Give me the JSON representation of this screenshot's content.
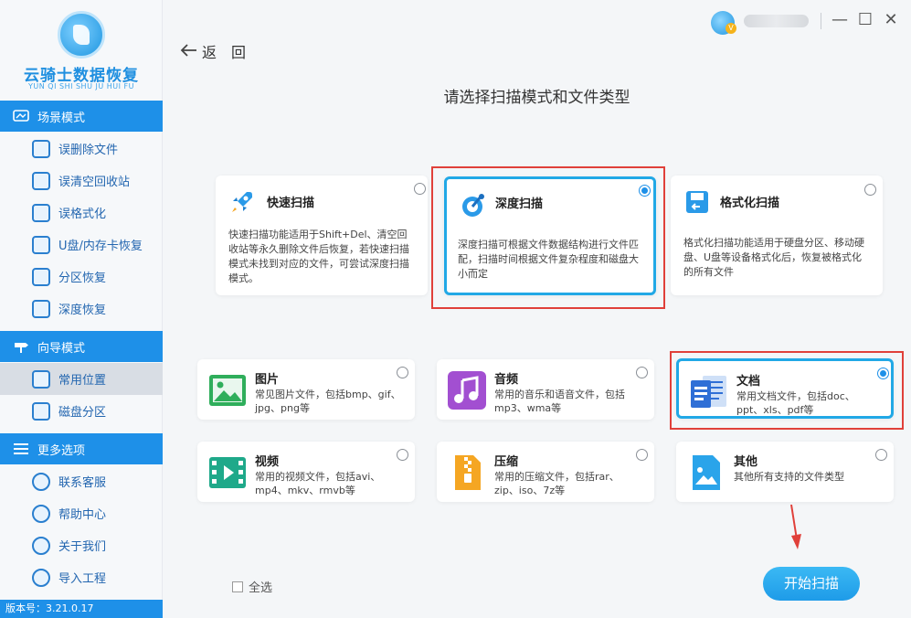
{
  "app": {
    "title": "云骑士数据恢复",
    "subtitle": "YUN QI SHI SHU JU HUI FU",
    "version": "版本号：3.21.0.17"
  },
  "sidebar": {
    "sections": [
      {
        "label": "场景模式",
        "items": [
          {
            "label": "误删除文件",
            "icon": "deleted-file-icon"
          },
          {
            "label": "误清空回收站",
            "icon": "recycle-bin-icon"
          },
          {
            "label": "误格式化",
            "icon": "format-icon"
          },
          {
            "label": "U盘/内存卡恢复",
            "icon": "usb-card-icon"
          },
          {
            "label": "分区恢复",
            "icon": "partition-icon"
          },
          {
            "label": "深度恢复",
            "icon": "deep-recovery-icon"
          }
        ]
      },
      {
        "label": "向导模式",
        "items": [
          {
            "label": "常用位置",
            "icon": "common-location-icon",
            "active": true
          },
          {
            "label": "磁盘分区",
            "icon": "disk-partition-icon"
          }
        ]
      },
      {
        "label": "更多选项",
        "items": [
          {
            "label": "联系客服",
            "icon": "customer-service-icon"
          },
          {
            "label": "帮助中心",
            "icon": "help-icon"
          },
          {
            "label": "关于我们",
            "icon": "about-icon"
          },
          {
            "label": "导入工程",
            "icon": "import-project-icon"
          }
        ]
      }
    ]
  },
  "header": {
    "back_label": "返　回",
    "window_controls": [
      "—",
      "☐",
      "✕"
    ]
  },
  "main": {
    "title": "请选择扫描模式和文件类型",
    "modes": [
      {
        "title": "快速扫描",
        "desc": "快速扫描功能适用于Shift+Del、清空回收站等永久删除文件后恢复，若快速扫描模式未找到对应的文件，可尝试深度扫描模式。",
        "selected": false,
        "icon": "rocket-icon"
      },
      {
        "title": "深度扫描",
        "desc": "深度扫描可根据文件数据结构进行文件匹配，扫描时间根据文件复杂程度和磁盘大小而定",
        "selected": true,
        "icon": "deep-scan-icon"
      },
      {
        "title": "格式化扫描",
        "desc": "格式化扫描功能适用于硬盘分区、移动硬盘、U盘等设备格式化后，恢复被格式化的所有文件",
        "selected": false,
        "icon": "format-scan-icon"
      }
    ],
    "file_types": [
      {
        "title": "图片",
        "desc": "常见图片文件，包括bmp、gif、jpg、png等",
        "selected": false,
        "icon": "image-icon",
        "color": "#2fae5b"
      },
      {
        "title": "音频",
        "desc": "常用的音乐和语音文件，包括mp3、wma等",
        "selected": false,
        "icon": "audio-icon",
        "color": "#a24fd1"
      },
      {
        "title": "文档",
        "desc": "常用文档文件，包括doc、ppt、xls、pdf等",
        "selected": true,
        "icon": "document-icon",
        "color": "#2f6fd6"
      },
      {
        "title": "视频",
        "desc": "常用的视频文件，包括avi、mp4、mkv、rmvb等",
        "selected": false,
        "icon": "video-icon",
        "color": "#1fa98a"
      },
      {
        "title": "压缩",
        "desc": "常用的压缩文件，包括rar、zip、iso、7z等",
        "selected": false,
        "icon": "archive-icon",
        "color": "#f5a623"
      },
      {
        "title": "其他",
        "desc": "其他所有支持的文件类型",
        "selected": false,
        "icon": "other-file-icon",
        "color": "#2aa4ea"
      }
    ],
    "select_all_label": "全选",
    "start_button_label": "开始扫描"
  },
  "colors": {
    "accent": "#1e90e8",
    "highlight": "#e0403a",
    "selected_border": "#21a8e6"
  }
}
